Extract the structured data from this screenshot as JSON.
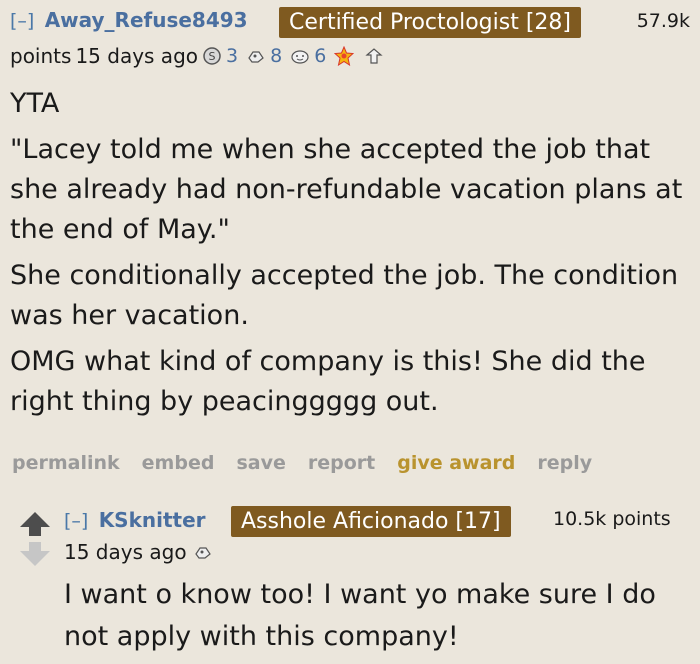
{
  "comment1": {
    "expand": "[–]",
    "author": "Away_Refuse8493",
    "flair": "Certified Proctologist [28]",
    "score": "57.9k",
    "points_label": "points",
    "age": "15 days ago",
    "awards": [
      {
        "icon": "silver-award-icon",
        "count": "3"
      },
      {
        "icon": "helpful-award-icon",
        "count": "8"
      },
      {
        "icon": "wholesome-award-icon",
        "count": "6"
      },
      {
        "icon": "starstruck-award-icon",
        "count": ""
      },
      {
        "icon": "hand-award-icon",
        "count": ""
      }
    ],
    "paragraphs": [
      "YTA",
      "\"Lacey told me when she accepted the job that she already had non-refundable vacation plans at the end of May.\"",
      "She conditionally accepted the job. The condition was her vacation.",
      "OMG what kind of company is this! She did the right thing by peacinggggg out."
    ],
    "actions": [
      "permalink",
      "embed",
      "save",
      "report",
      "give award",
      "reply"
    ]
  },
  "comment2": {
    "expand": "[–]",
    "author": "KSknitter",
    "flair": "Asshole Aficionado [17]",
    "score": "10.5k points",
    "age": "15 days ago",
    "body": "I want o know too! I want yo make sure I do not apply with this company!"
  },
  "colors": {
    "background": "#ebe6dc",
    "flair_bg": "#7f5a20",
    "link": "#4a6fa0",
    "gold": "#b9932e"
  }
}
